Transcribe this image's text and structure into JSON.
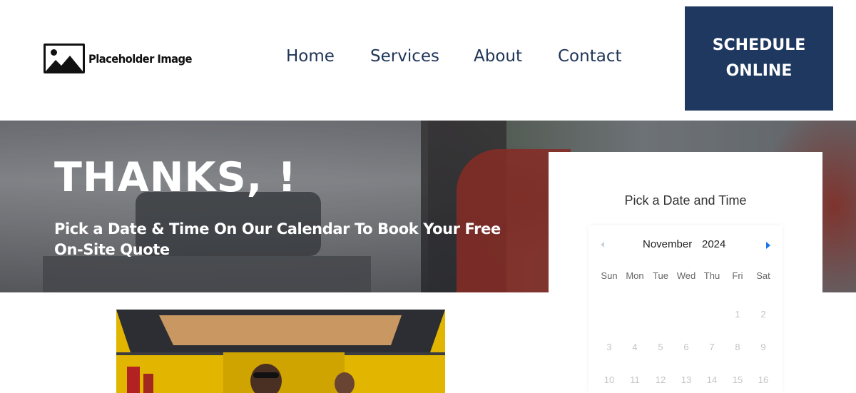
{
  "header": {
    "logo_text": "Placeholder Image",
    "nav": [
      "Home",
      "Services",
      "About",
      "Contact"
    ],
    "cta_line1": "SCHEDULE",
    "cta_line2": "ONLINE"
  },
  "hero": {
    "title": "THANKS, !",
    "subtitle": "Pick a Date & Time On Our Calendar To Book Your Free On-Site Quote"
  },
  "scheduler": {
    "title": "Pick a Date and Time",
    "month": "November",
    "year": "2024",
    "weekdays": [
      "Sun",
      "Mon",
      "Tue",
      "Wed",
      "Thu",
      "Fri",
      "Sat"
    ],
    "days": [
      "1",
      "2",
      "3",
      "4",
      "5",
      "6",
      "7",
      "8",
      "9",
      "10",
      "11",
      "12",
      "13",
      "14",
      "15",
      "16"
    ]
  },
  "colors": {
    "nav_text": "#1f3557",
    "cta_bg": "#1e3860",
    "next_arrow": "#1a73e8"
  },
  "icons": {
    "logo": "image-placeholder-icon",
    "prev": "chevron-left-icon",
    "next": "chevron-right-icon"
  }
}
